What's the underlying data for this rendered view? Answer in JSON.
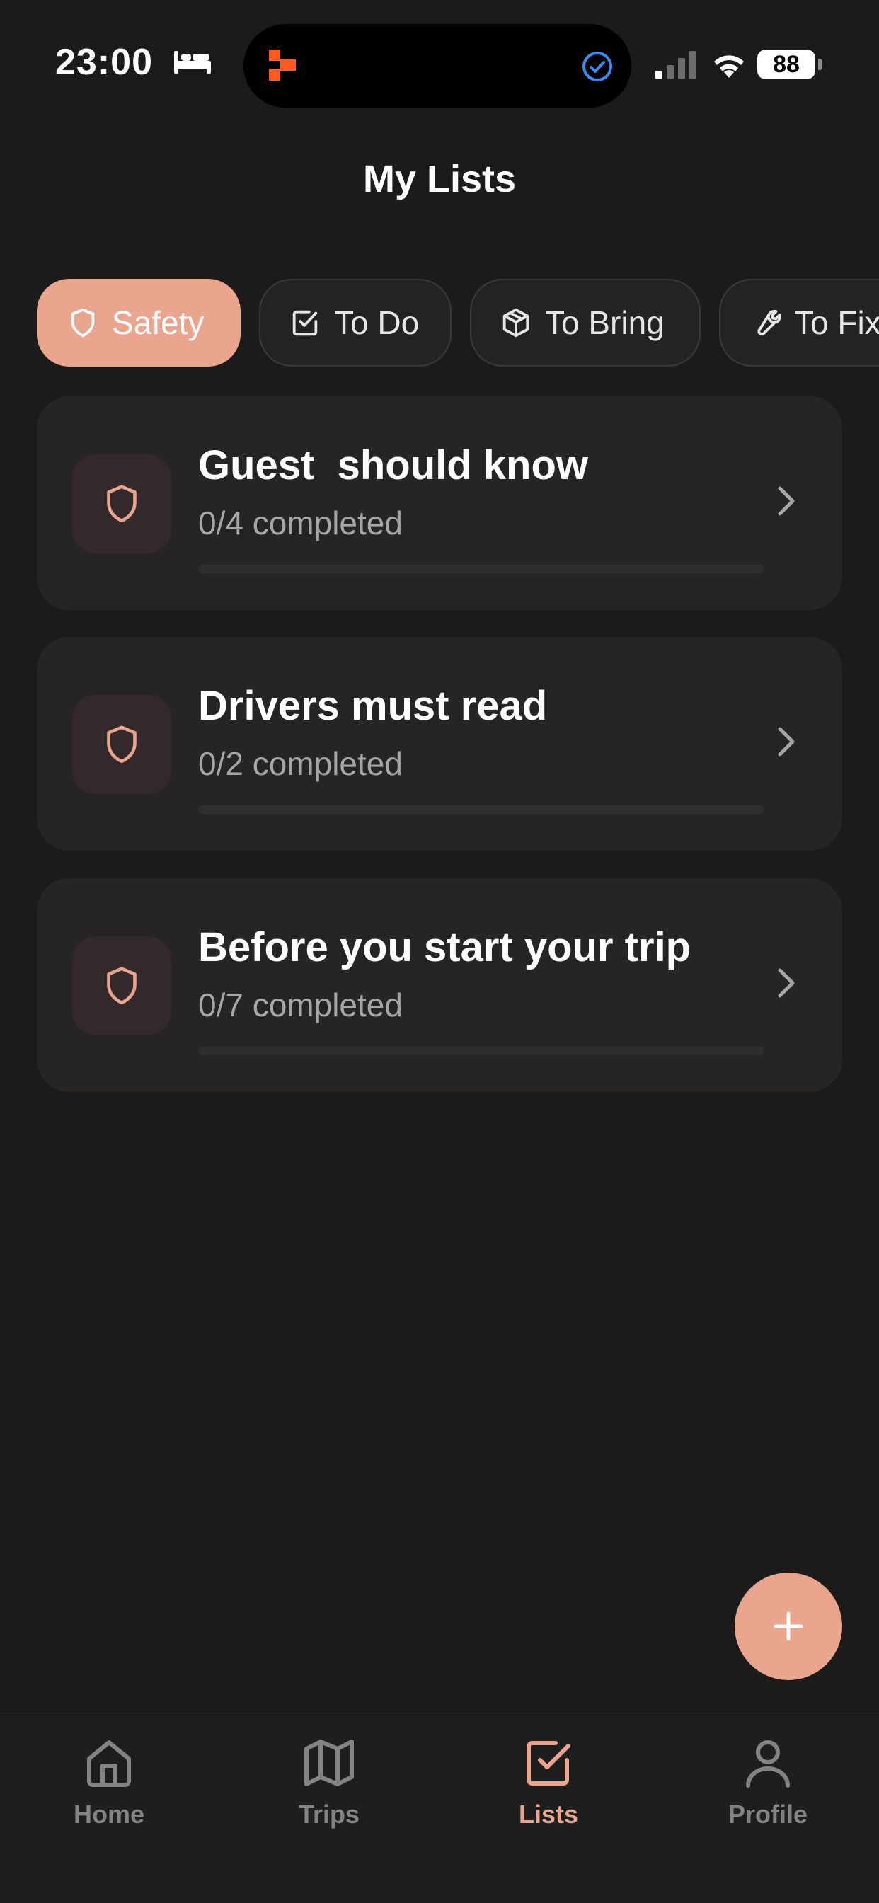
{
  "status_bar": {
    "time": "23:00",
    "battery": "88"
  },
  "header": {
    "title": "My Lists"
  },
  "categories": [
    {
      "label": "Safety",
      "icon": "shield-icon",
      "active": true
    },
    {
      "label": "To Do",
      "icon": "checkbox-icon",
      "active": false
    },
    {
      "label": "To Bring",
      "icon": "box-icon",
      "active": false
    },
    {
      "label": "To Fix",
      "icon": "wrench-icon",
      "active": false
    }
  ],
  "lists": [
    {
      "title": "Guest  should know",
      "subtitle": "0/4 completed",
      "progress": 0
    },
    {
      "title": "Drivers must read",
      "subtitle": "0/2 completed",
      "progress": 0
    },
    {
      "title": "Before you start your trip",
      "subtitle": "0/7 completed",
      "progress": 0
    }
  ],
  "nav": [
    {
      "label": "Home",
      "icon": "home-icon",
      "active": false
    },
    {
      "label": "Trips",
      "icon": "map-icon",
      "active": false
    },
    {
      "label": "Lists",
      "icon": "checkbox-icon",
      "active": true
    },
    {
      "label": "Profile",
      "icon": "user-icon",
      "active": false
    }
  ],
  "colors": {
    "accent": "#e9a58d",
    "background": "#1c1b1b",
    "card": "#262524"
  }
}
